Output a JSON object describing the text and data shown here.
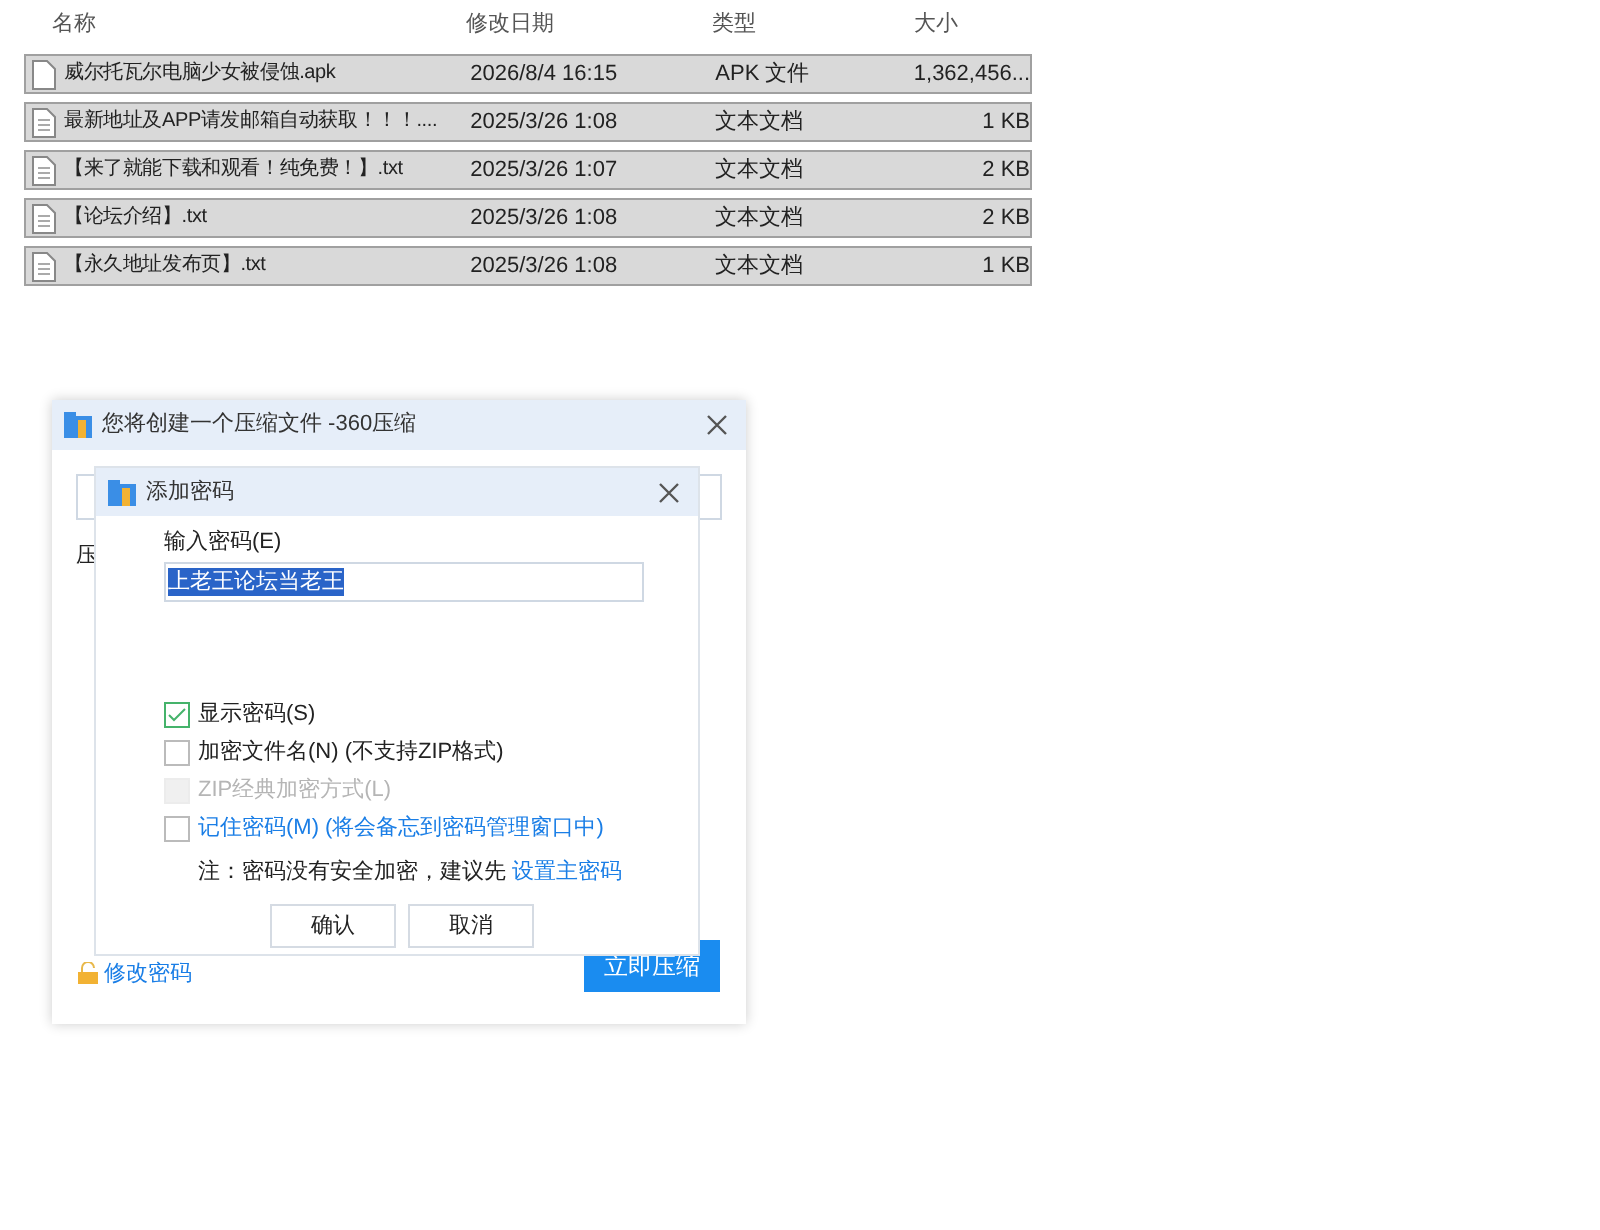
{
  "file_list": {
    "columns": [
      "名称",
      "修改日期",
      "类型",
      "大小"
    ],
    "rows": [
      {
        "kind": "blank",
        "name": "威尔托瓦尔电脑少女被侵蚀.apk",
        "date": "2026/8/4 16:15",
        "type": "APK 文件",
        "size": "1,362,456...",
        "selected": true
      },
      {
        "kind": "text",
        "name": "最新地址及APP请发邮箱自动获取！！！....",
        "date": "2025/3/26 1:08",
        "type": "文本文档",
        "size": "1 KB",
        "selected": true
      },
      {
        "kind": "text",
        "name": "【来了就能下载和观看！纯免费！】.txt",
        "date": "2025/3/26 1:07",
        "type": "文本文档",
        "size": "2 KB",
        "selected": true
      },
      {
        "kind": "text",
        "name": "【论坛介绍】.txt",
        "date": "2025/3/26 1:08",
        "type": "文本文档",
        "size": "2 KB",
        "selected": true
      },
      {
        "kind": "text",
        "name": "【永久地址发布页】.txt",
        "date": "2025/3/26 1:08",
        "type": "文本文档",
        "size": "1 KB",
        "selected": true
      }
    ]
  },
  "compress_dialog": {
    "title": "您将创建一个压缩文件 -360压缩",
    "label": "压",
    "modify_password_link": "修改密码",
    "compress_button": "立即压缩"
  },
  "password_dialog": {
    "title": "添加密码",
    "password_label": "输入密码(E)",
    "password_value": "上老王论坛当老王",
    "options": [
      {
        "label": "显示密码(S)",
        "checked": true,
        "disabled": false,
        "link": false
      },
      {
        "label": "加密文件名(N) (不支持ZIP格式)",
        "checked": false,
        "disabled": false,
        "link": false
      },
      {
        "label": "ZIP经典加密方式(L)",
        "checked": false,
        "disabled": true,
        "link": false
      },
      {
        "label": "记住密码(M) (将会备忘到密码管理窗口中)",
        "checked": false,
        "disabled": false,
        "link": true
      }
    ],
    "note": "注：密码没有安全加密，建议先",
    "note_link": "设置主密码",
    "buttons": [
      "确认",
      "取消"
    ]
  }
}
